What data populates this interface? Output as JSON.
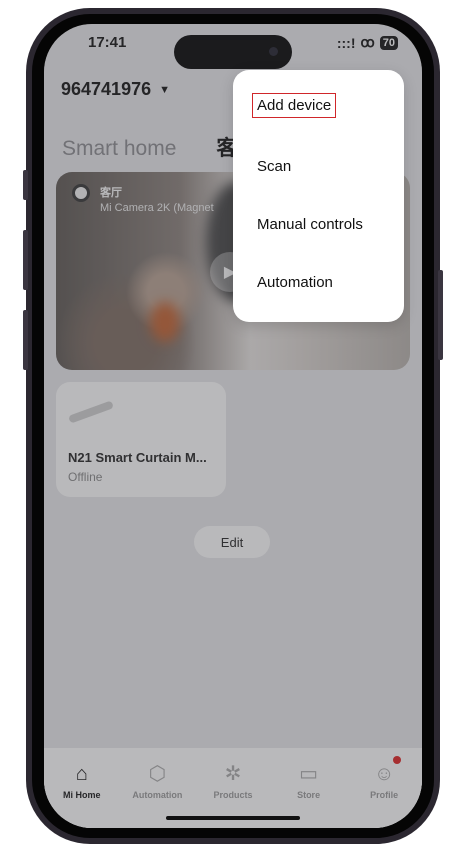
{
  "status": {
    "time": "17:41",
    "signal": ":::!",
    "link_glyph": "ꝏ",
    "battery": "70"
  },
  "header": {
    "account": "964741976"
  },
  "tabs": [
    {
      "label": "Smart home"
    },
    {
      "label": "客"
    }
  ],
  "camera_card": {
    "room": "客厅",
    "name": "Mi Camera 2K (Magnet"
  },
  "device_card": {
    "name": "N21 Smart Curtain M...",
    "status": "Offline"
  },
  "edit_label": "Edit",
  "menu": {
    "items": [
      "Add device",
      "Scan",
      "Manual controls",
      "Automation"
    ],
    "highlighted": "Add device"
  },
  "bottom_nav": [
    {
      "label": "Mi Home",
      "icon": "home-icon",
      "active": true
    },
    {
      "label": "Automation",
      "icon": "automation-icon",
      "active": false
    },
    {
      "label": "Products",
      "icon": "products-icon",
      "active": false
    },
    {
      "label": "Store",
      "icon": "store-icon",
      "active": false
    },
    {
      "label": "Profile",
      "icon": "profile-icon",
      "active": false
    }
  ],
  "colors": {
    "highlight": "#d0262a",
    "notification_dot": "#e02020"
  }
}
